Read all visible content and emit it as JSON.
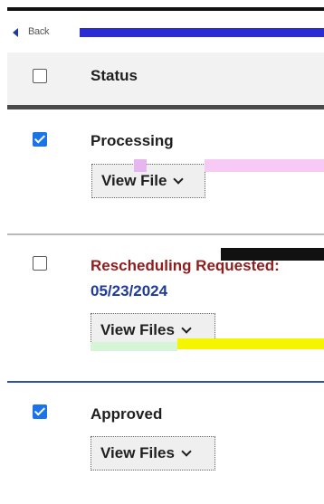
{
  "topbar": {
    "back_label": "Back"
  },
  "table": {
    "header": {
      "status_label": "Status"
    },
    "rows": [
      {
        "checked": true,
        "status": "Processing",
        "date": "",
        "button_label": "View File"
      },
      {
        "checked": false,
        "status": "Rescheduling Requested:",
        "date": "05/23/2024",
        "button_label": "View Files"
      },
      {
        "checked": true,
        "status": "Approved",
        "date": "",
        "button_label": "View Files"
      }
    ]
  },
  "colors": {
    "accent": "#1a73e8",
    "link_blue": "#1f3a9e",
    "warning_red": "#8f1d1d",
    "header_bg": "#f2f2f2"
  }
}
